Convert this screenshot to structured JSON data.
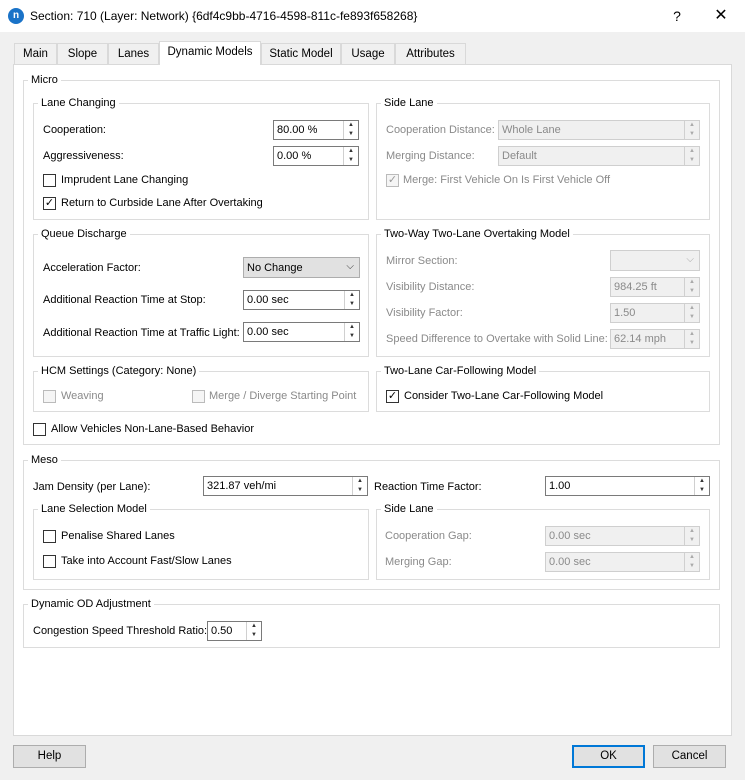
{
  "window": {
    "title": "Section: 710 (Layer: Network) {6df4c9bb-4716-4598-811c-fe893f658268}",
    "icon_letter": "n",
    "help_glyph": "?",
    "close_glyph": "✕"
  },
  "tabs": [
    {
      "label": "Main"
    },
    {
      "label": "Slope"
    },
    {
      "label": "Lanes"
    },
    {
      "label": "Dynamic Models"
    },
    {
      "label": "Static Model"
    },
    {
      "label": "Usage"
    },
    {
      "label": "Attributes"
    }
  ],
  "micro": {
    "title": "Micro",
    "lane_changing": {
      "title": "Lane Changing",
      "cooperation_label": "Cooperation:",
      "cooperation_value": "80.00 %",
      "aggressiveness_label": "Aggressiveness:",
      "aggressiveness_value": "0.00 %",
      "imprudent_label": "Imprudent Lane Changing",
      "imprudent_checked": "",
      "return_label": "Return to Curbside Lane After Overtaking",
      "return_checked": "✓"
    },
    "side_lane": {
      "title": "Side Lane",
      "coop_distance_label": "Cooperation Distance:",
      "coop_distance_value": "Whole Lane",
      "merging_distance_label": "Merging Distance:",
      "merging_distance_value": "Default",
      "merge_label": "Merge: First Vehicle On Is First Vehicle Off",
      "merge_checked": "✓"
    },
    "queue_discharge": {
      "title": "Queue Discharge",
      "accel_label": "Acceleration Factor:",
      "accel_value": "No Change",
      "stop_label": "Additional Reaction Time at Stop:",
      "stop_value": "0.00 sec",
      "light_label": "Additional Reaction Time at Traffic Light:",
      "light_value": "0.00 sec"
    },
    "overtaking": {
      "title": "Two-Way Two-Lane Overtaking Model",
      "mirror_label": "Mirror Section:",
      "mirror_value": "",
      "visibility_distance_label": "Visibility Distance:",
      "visibility_distance_value": "984.25 ft",
      "visibility_factor_label": "Visibility Factor:",
      "visibility_factor_value": "1.50",
      "speed_diff_label": "Speed Difference to Overtake with Solid Line:",
      "speed_diff_value": "62.14 mph"
    },
    "hcm": {
      "title": "HCM Settings (Category: None)",
      "weaving_label": "Weaving",
      "weaving_checked": "",
      "merge_label": "Merge / Diverge Starting Point",
      "merge_checked": ""
    },
    "car_following": {
      "title": "Two-Lane Car-Following Model",
      "consider_label": "Consider Two-Lane Car-Following Model",
      "consider_checked": "✓"
    },
    "allow_label": "Allow Vehicles Non-Lane-Based Behavior",
    "allow_checked": ""
  },
  "meso": {
    "title": "Meso",
    "jam_label": "Jam Density (per Lane):",
    "jam_value": "321.87 veh/mi",
    "reaction_label": "Reaction Time Factor:",
    "reaction_value": "1.00",
    "lane_selection": {
      "title": "Lane Selection Model",
      "penalise_label": "Penalise Shared Lanes",
      "penalise_checked": "",
      "fastslow_label": "Take into Account Fast/Slow Lanes",
      "fastslow_checked": ""
    },
    "side_lane": {
      "title": "Side Lane",
      "coop_gap_label": "Cooperation Gap:",
      "coop_gap_value": "0.00 sec",
      "merging_gap_label": "Merging Gap:",
      "merging_gap_value": "0.00 sec"
    }
  },
  "dynamic_od": {
    "title": "Dynamic OD Adjustment",
    "congestion_label": "Congestion Speed Threshold Ratio:",
    "congestion_value": "0.50"
  },
  "buttons": {
    "help": "Help",
    "ok": "OK",
    "cancel": "Cancel"
  },
  "glyphs": {
    "up": "▲",
    "down": "▼",
    "chevron": "⌵"
  },
  "colors": {
    "accent": "#0078d7",
    "icon": "#1a73c8"
  }
}
